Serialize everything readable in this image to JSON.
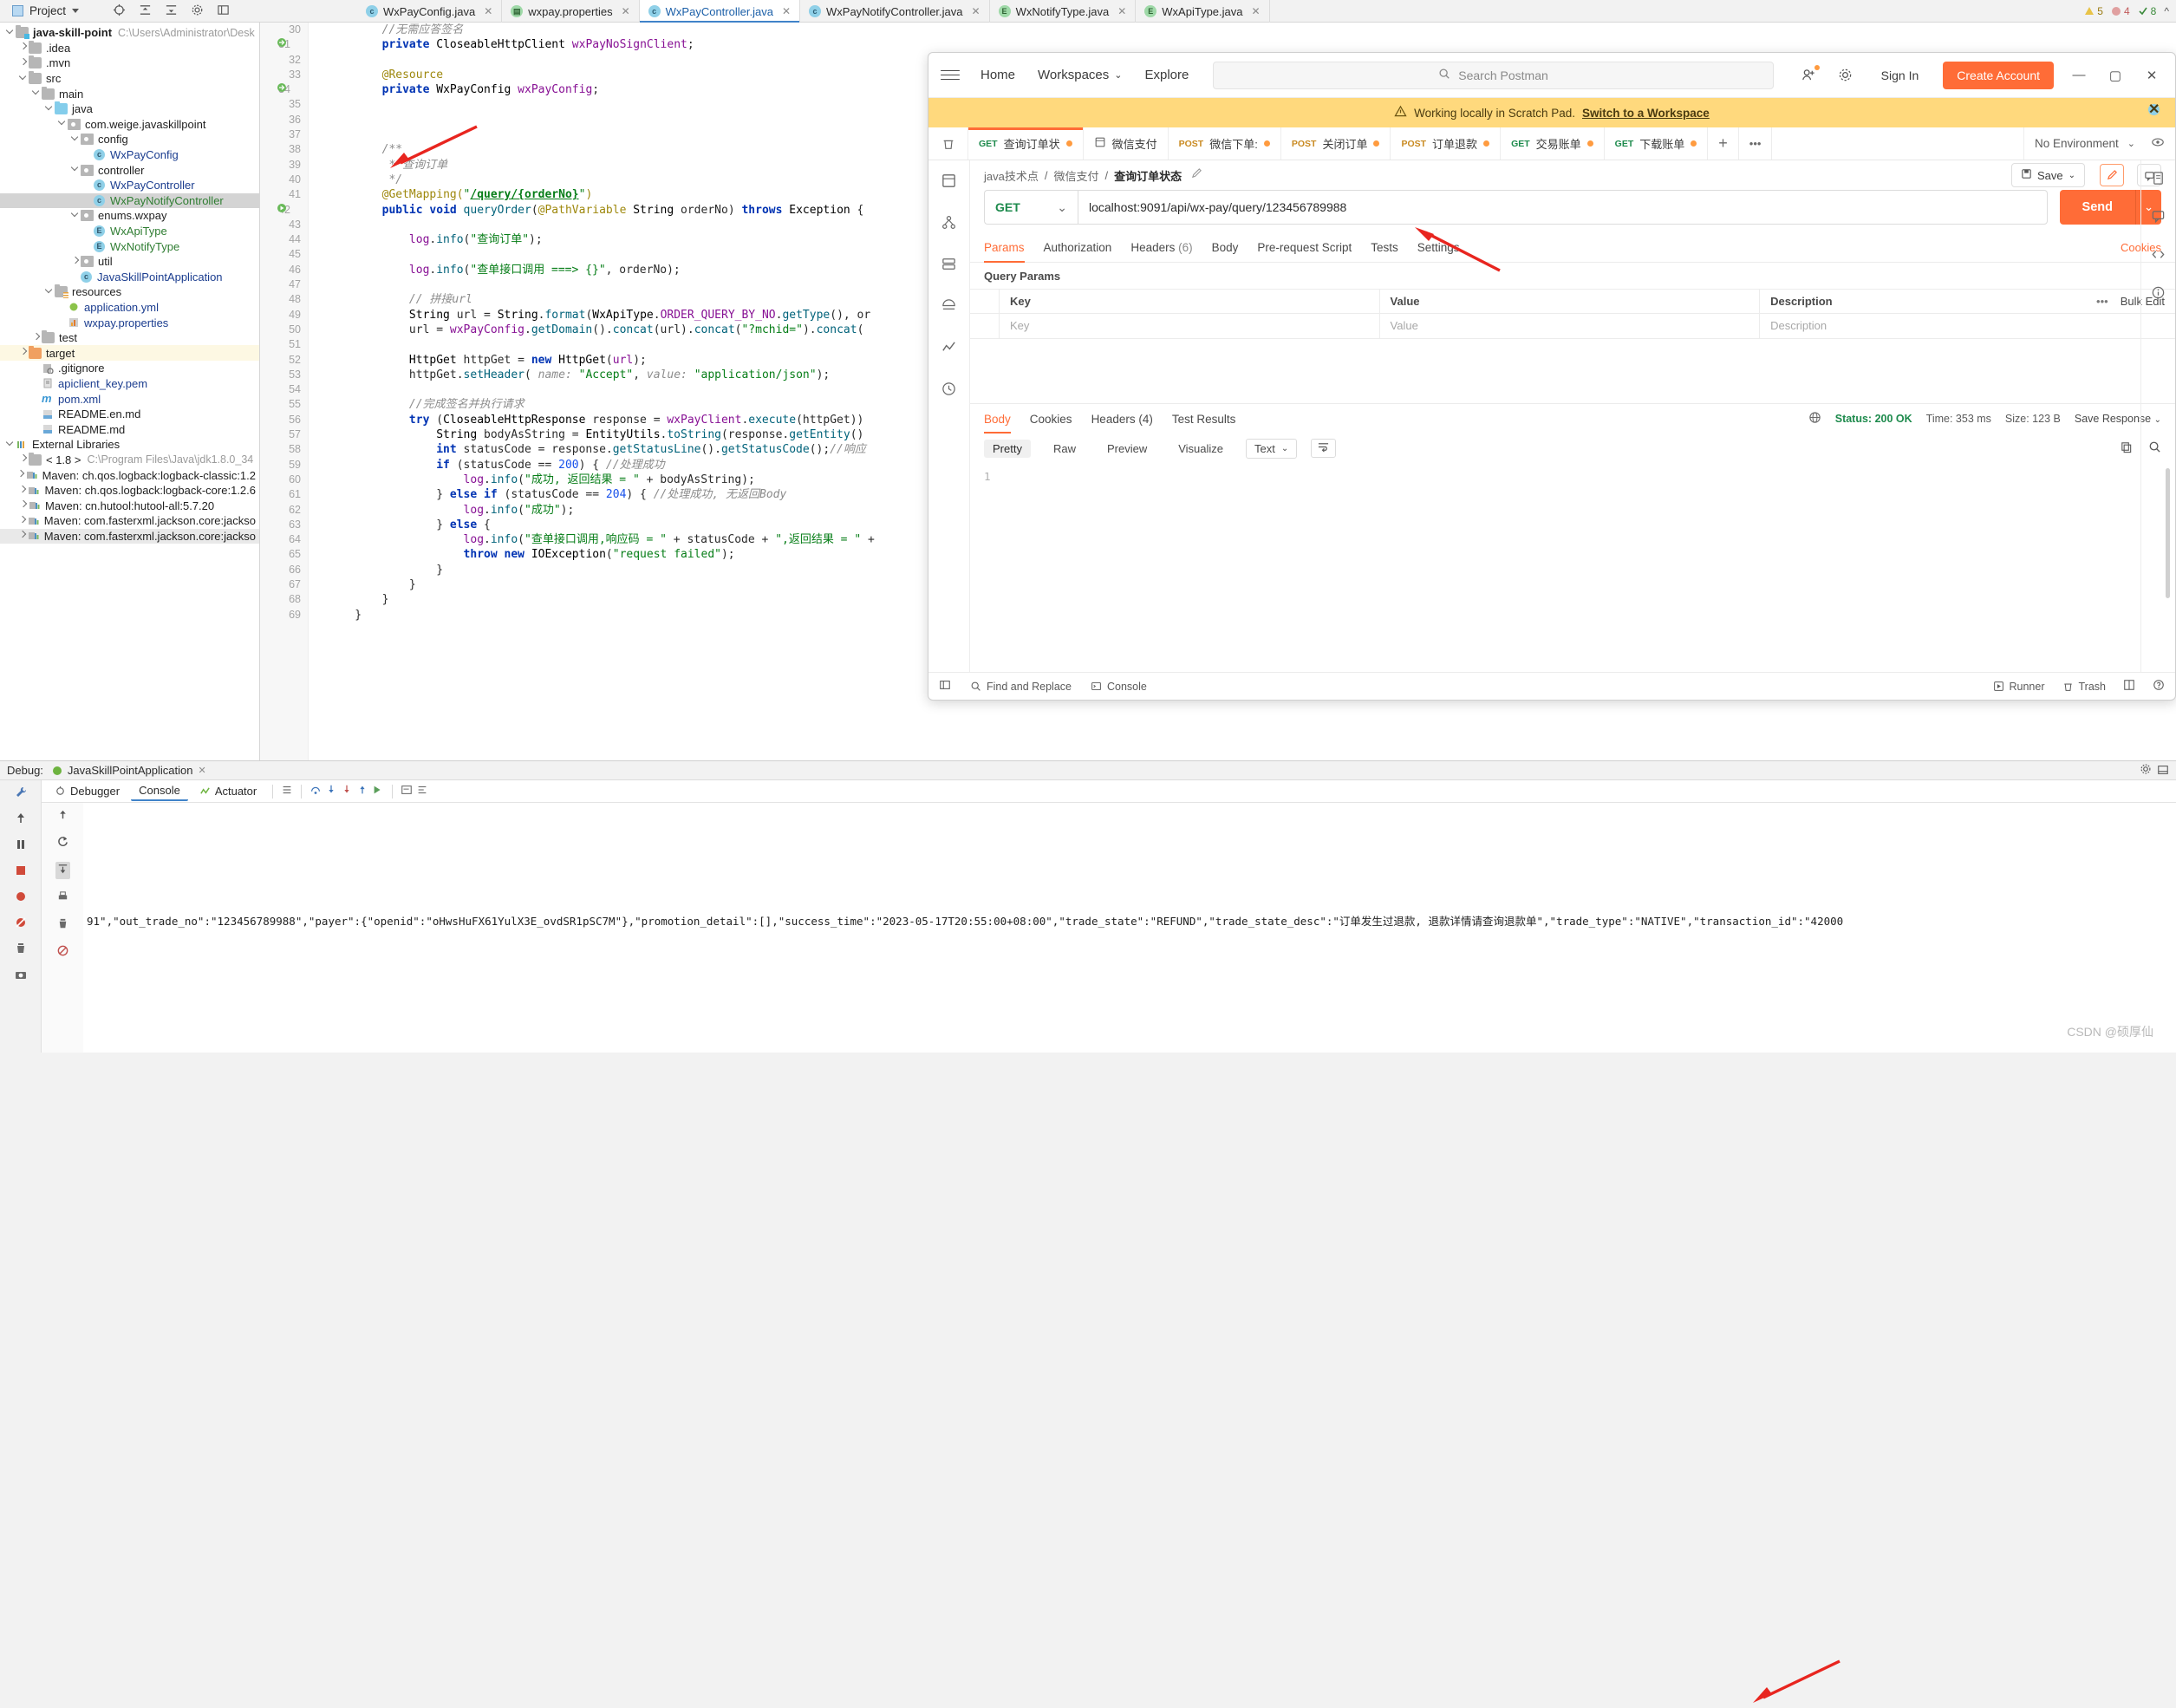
{
  "ide": {
    "toolbar": {
      "project_label": "Project",
      "status_warn": "5",
      "status_err": "4",
      "status_ok": "8"
    },
    "editor_tabs": [
      {
        "label": "WxPayConfig.java",
        "icon": "java-class-icon",
        "active": false
      },
      {
        "label": "wxpay.properties",
        "icon": "properties-file-icon",
        "active": false
      },
      {
        "label": "WxPayController.java",
        "icon": "java-class-icon",
        "active": true
      },
      {
        "label": "WxPayNotifyController.java",
        "icon": "java-class-icon",
        "active": false
      },
      {
        "label": "WxNotifyType.java",
        "icon": "java-enum-icon",
        "active": false
      },
      {
        "label": "WxApiType.java",
        "icon": "java-enum-icon",
        "active": false
      }
    ],
    "tree": [
      {
        "indent": 0,
        "chev": "down",
        "icon": "module-folder",
        "label": "java-skill-point",
        "bold": true,
        "path": "C:\\Users\\Administrator\\Desk",
        "color": "dark"
      },
      {
        "indent": 1,
        "chev": "right",
        "icon": "folder",
        "label": ".idea",
        "color": "dark"
      },
      {
        "indent": 1,
        "chev": "right",
        "icon": "folder",
        "label": ".mvn",
        "color": "dark"
      },
      {
        "indent": 1,
        "chev": "down",
        "icon": "folder",
        "label": "src",
        "color": "dark"
      },
      {
        "indent": 2,
        "chev": "down",
        "icon": "folder",
        "label": "main",
        "color": "dark"
      },
      {
        "indent": 3,
        "chev": "down",
        "icon": "source-folder",
        "label": "java",
        "color": "dark"
      },
      {
        "indent": 4,
        "chev": "down",
        "icon": "package",
        "label": "com.weige.javaskillpoint",
        "color": "dark"
      },
      {
        "indent": 5,
        "chev": "down",
        "icon": "package",
        "label": "config",
        "color": "dark"
      },
      {
        "indent": 6,
        "chev": "none",
        "icon": "class",
        "label": "WxPayConfig",
        "color": "blue"
      },
      {
        "indent": 5,
        "chev": "down",
        "icon": "package",
        "label": "controller",
        "color": "dark"
      },
      {
        "indent": 6,
        "chev": "none",
        "icon": "class",
        "label": "WxPayController",
        "color": "blue"
      },
      {
        "indent": 6,
        "chev": "none",
        "icon": "class",
        "label": "WxPayNotifyController",
        "color": "green",
        "selected": true
      },
      {
        "indent": 5,
        "chev": "down",
        "icon": "package",
        "label": "enums.wxpay",
        "color": "dark"
      },
      {
        "indent": 6,
        "chev": "none",
        "icon": "enum",
        "label": "WxApiType",
        "color": "green"
      },
      {
        "indent": 6,
        "chev": "none",
        "icon": "enum",
        "label": "WxNotifyType",
        "color": "green"
      },
      {
        "indent": 5,
        "chev": "right",
        "icon": "package",
        "label": "util",
        "color": "dark"
      },
      {
        "indent": 5,
        "chev": "none",
        "icon": "springboot",
        "label": "JavaSkillPointApplication",
        "color": "blue"
      },
      {
        "indent": 3,
        "chev": "down",
        "icon": "resource-folder",
        "label": "resources",
        "color": "dark"
      },
      {
        "indent": 4,
        "chev": "none",
        "icon": "yml",
        "label": "application.yml",
        "color": "blue"
      },
      {
        "indent": 4,
        "chev": "none",
        "icon": "properties",
        "label": "wxpay.properties",
        "color": "blue"
      },
      {
        "indent": 2,
        "chev": "right",
        "icon": "folder",
        "label": "test",
        "color": "dark"
      },
      {
        "indent": 1,
        "chev": "right",
        "icon": "target-folder",
        "label": "target",
        "color": "dark",
        "highlight": true
      },
      {
        "indent": 2,
        "chev": "none",
        "icon": "gitignore",
        "label": ".gitignore",
        "color": "dark"
      },
      {
        "indent": 2,
        "chev": "none",
        "icon": "pem",
        "label": "apiclient_key.pem",
        "color": "blue"
      },
      {
        "indent": 2,
        "chev": "none",
        "icon": "maven",
        "label": "pom.xml",
        "color": "blue"
      },
      {
        "indent": 2,
        "chev": "none",
        "icon": "markdown",
        "label": "README.en.md",
        "color": "dark"
      },
      {
        "indent": 2,
        "chev": "none",
        "icon": "markdown",
        "label": "README.md",
        "color": "dark"
      },
      {
        "indent": 0,
        "chev": "down",
        "icon": "libraries",
        "label": "External Libraries",
        "color": "dark"
      },
      {
        "indent": 1,
        "chev": "right",
        "icon": "jdk",
        "label": "< 1.8 >",
        "path": "C:\\Program Files\\Java\\jdk1.8.0_34",
        "color": "dark"
      },
      {
        "indent": 1,
        "chev": "right",
        "icon": "lib",
        "label": "Maven: ch.qos.logback:logback-classic:1.2",
        "color": "dark"
      },
      {
        "indent": 1,
        "chev": "right",
        "icon": "lib",
        "label": "Maven: ch.qos.logback:logback-core:1.2.6",
        "color": "dark"
      },
      {
        "indent": 1,
        "chev": "right",
        "icon": "lib",
        "label": "Maven: cn.hutool:hutool-all:5.7.20",
        "color": "dark"
      },
      {
        "indent": 1,
        "chev": "right",
        "icon": "lib",
        "label": "Maven: com.fasterxml.jackson.core:jackso",
        "color": "dark"
      },
      {
        "indent": 1,
        "chev": "right",
        "icon": "lib",
        "label": "Maven: com.fasterxml.jackson.core:jackso",
        "color": "dark",
        "selected2": true
      }
    ],
    "code": {
      "first_line": 30,
      "lines": [
        {
          "n": 30,
          "html": "        <span class='cm'>//无需应答签名</span>"
        },
        {
          "n": 31,
          "html": "        <span class='k'>private</span> <span class='ty'>CloseableHttpClient</span> <span class='fld'>wxPayNoSignClient</span>;",
          "mark": "override"
        },
        {
          "n": 32,
          "html": ""
        },
        {
          "n": 33,
          "html": "        <span class='an'>@Resource</span>"
        },
        {
          "n": 34,
          "html": "        <span class='k'>private</span> <span class='ty'>WxPayConfig</span> <span class='fld'>wxPayConfig</span>;",
          "mark": "override"
        },
        {
          "n": 35,
          "html": "",
          "fold": "run"
        },
        {
          "n": 36,
          "html": "",
          "fold": "run"
        },
        {
          "n": 37,
          "html": ""
        },
        {
          "n": 38,
          "html": "        <span class='cm'>/**</span>",
          "fold": "open"
        },
        {
          "n": 39,
          "html": "         <span class='cm'>* 查询订单</span>"
        },
        {
          "n": 40,
          "html": "         <span class='cm'>*/</span>",
          "fold": "close"
        },
        {
          "n": 41,
          "html": "        <span class='an'>@GetMapping(</span><span class='st'>\"</span><span class='ul'>/query/{orderNo}</span><span class='st'>\"</span><span class='an'>)</span>"
        },
        {
          "n": 42,
          "html": "        <span class='k'>public void</span> <span class='mth'>queryOrder</span>(<span class='an'>@PathVariable</span> <span class='ty'>String</span> orderNo) <span class='k'>throws</span> <span class='ty'>Exception</span> {",
          "mark": "run",
          "fold": "open"
        },
        {
          "n": 43,
          "html": ""
        },
        {
          "n": 44,
          "html": "            <span class='fld'>log</span>.<span class='mth'>info</span>(<span class='st'>\"查询订单\"</span>);"
        },
        {
          "n": 45,
          "html": ""
        },
        {
          "n": 46,
          "html": "            <span class='fld'>log</span>.<span class='mth'>info</span>(<span class='st'>\"查单接口调用 ===&gt; {}\"</span>, orderNo);"
        },
        {
          "n": 47,
          "html": ""
        },
        {
          "n": 48,
          "html": "            <span class='cm'>// 拼接url</span>"
        },
        {
          "n": 49,
          "html": "            <span class='ty'>String</span> url = <span class='ty'>String</span>.<span class='mth'>format</span>(<span class='ty'>WxApiType</span>.<span class='fld'>ORDER_QUERY_BY_NO</span>.<span class='mth'>getType</span>(), or"
        },
        {
          "n": 50,
          "html": "            url = <span class='fld'>wxPayConfig</span>.<span class='mth'>getDomain</span>().<span class='mth'>concat</span>(url).<span class='mth'>concat</span>(<span class='st'>\"?mchid=\"</span>).<span class='mth'>concat</span>("
        },
        {
          "n": 51,
          "html": ""
        },
        {
          "n": 52,
          "html": "            <span class='ty'>HttpGet</span> httpGet = <span class='k'>new</span> <span class='ty'>HttpGet</span>(<span class='fld'>url</span>);"
        },
        {
          "n": 53,
          "html": "            httpGet.<span class='mth'>setHeader</span>( <span class='cm'>name:</span> <span class='st'>\"Accept\"</span>, <span class='cm'>value:</span> <span class='st'>\"application/json\"</span>);"
        },
        {
          "n": 54,
          "html": ""
        },
        {
          "n": 55,
          "html": "            <span class='cm'>//完成签名并执行请求</span>"
        },
        {
          "n": 56,
          "html": "            <span class='k'>try</span> (<span class='ty'>CloseableHttpResponse</span> response = <span class='fld'>wxPayClient</span>.<span class='mth'>execute</span>(httpGet))",
          "fold": "open"
        },
        {
          "n": 57,
          "html": "                <span class='ty'>String</span> bodyAsString = <span class='ty'>EntityUtils</span>.<span class='mth'>toString</span>(response.<span class='mth'>getEntity</span>()"
        },
        {
          "n": 58,
          "html": "                <span class='k'>int</span> statusCode = response.<span class='mth'>getStatusLine</span>().<span class='mth'>getStatusCode</span>();<span class='cm'>//响应</span>"
        },
        {
          "n": 59,
          "html": "                <span class='k'>if</span> (statusCode == <span class='nu'>200</span>) { <span class='cm'>//处理成功</span>"
        },
        {
          "n": 60,
          "html": "                    <span class='fld'>log</span>.<span class='mth'>info</span>(<span class='st'>\"成功, 返回结果 = \"</span> + bodyAsString);"
        },
        {
          "n": 61,
          "html": "                } <span class='k'>else if</span> (statusCode == <span class='nu'>204</span>) { <span class='cm'>//处理成功, 无返回Body</span>"
        },
        {
          "n": 62,
          "html": "                    <span class='fld'>log</span>.<span class='mth'>info</span>(<span class='st'>\"成功\"</span>);"
        },
        {
          "n": 63,
          "html": "                } <span class='k'>else</span> {"
        },
        {
          "n": 64,
          "html": "                    <span class='fld'>log</span>.<span class='mth'>info</span>(<span class='st'>\"查单接口调用,响应码 = \"</span> + statusCode + <span class='st'>\",返回结果 = \"</span> +"
        },
        {
          "n": 65,
          "html": "                    <span class='k'>throw new</span> <span class='ty'>IOException</span>(<span class='st'>\"request failed\"</span>);"
        },
        {
          "n": 66,
          "html": "                }"
        },
        {
          "n": 67,
          "html": "            }"
        },
        {
          "n": 68,
          "html": "        }"
        },
        {
          "n": 69,
          "html": "    }"
        }
      ]
    },
    "debug": {
      "label": "Debug:",
      "config_name": "JavaSkillPointApplication",
      "tabs": [
        {
          "label": "Debugger",
          "icon": "debugger-icon",
          "active": false
        },
        {
          "label": "Console",
          "icon": "console-icon",
          "active": true
        },
        {
          "label": "Actuator",
          "icon": "actuator-icon",
          "active": false
        }
      ],
      "console_text": "91\",\"out_trade_no\":\"123456789988\",\"payer\":{\"openid\":\"oHwsHuFX61YulX3E_ovdSR1pSC7M\"},\"promotion_detail\":[],\"success_time\":\"2023-05-17T20:55:00+08:00\",\"trade_state\":\"REFUND\",\"trade_state_desc\":\"订单发生过退款, 退款详情请查询退款单\",\"trade_type\":\"NATIVE\",\"transaction_id\":\"42000"
    },
    "watermark": "CSDN @硕厚仙"
  },
  "postman": {
    "titlebar": {
      "menu_icon": "hamburger-icon",
      "nav": [
        {
          "label": "Home",
          "caret": false
        },
        {
          "label": "Workspaces",
          "caret": true
        },
        {
          "label": "Explore",
          "caret": false
        }
      ],
      "search_placeholder": "Search Postman",
      "search_icon": "search-icon",
      "invite_icon": "invite-icon",
      "settings_icon": "gear-icon",
      "signin_label": "Sign In",
      "create_account_label": "Create Account",
      "minimize_icon": "minimize-icon",
      "maximize_icon": "maximize-icon",
      "close_icon": "close-icon"
    },
    "banner": {
      "icon": "warning-icon",
      "text": "Working locally in Scratch Pad.",
      "link": "Switch to a Workspace",
      "close_icon": "close-icon"
    },
    "tabs": [
      {
        "verb": "GET",
        "label": "查询订单状",
        "dirty": true,
        "active": true,
        "icon": ""
      },
      {
        "verb": "",
        "label": "微信支付",
        "dirty": false,
        "active": false,
        "icon": "collection-icon"
      },
      {
        "verb": "POST",
        "label": "微信下单:",
        "dirty": true,
        "active": false
      },
      {
        "verb": "POST",
        "label": "关闭订单",
        "dirty": true,
        "active": false
      },
      {
        "verb": "POST",
        "label": "订单退款",
        "dirty": true,
        "active": false
      },
      {
        "verb": "GET",
        "label": "交易账单",
        "dirty": true,
        "active": false
      },
      {
        "verb": "GET",
        "label": "下载账单",
        "dirty": true,
        "active": false
      }
    ],
    "tab_add_label": "+",
    "tab_more_label": "•••",
    "environment": {
      "value": "No Environment",
      "eye_icon": "eye-icon",
      "caret_icon": "chevron-down-icon"
    },
    "breadcrumb": {
      "parts": [
        "java技术点",
        "微信支付"
      ],
      "current": "查询订单状态",
      "edit_icon": "pencil-icon"
    },
    "save_label": "Save",
    "save_icon": "save-icon",
    "request": {
      "method": "GET",
      "method_caret": "chevron-down-icon",
      "url": "localhost:9091/api/wx-pay/query/123456789988",
      "send_label": "Send",
      "send_caret": "chevron-down-icon"
    },
    "request_tabs": [
      {
        "label": "Params",
        "count": "",
        "active": true
      },
      {
        "label": "Authorization",
        "count": "",
        "active": false
      },
      {
        "label": "Headers",
        "count": "(6)",
        "active": false
      },
      {
        "label": "Body",
        "count": "",
        "active": false
      },
      {
        "label": "Pre-request Script",
        "count": "",
        "active": false
      },
      {
        "label": "Tests",
        "count": "",
        "active": false
      },
      {
        "label": "Settings",
        "count": "",
        "active": false
      }
    ],
    "cookies_label": "Cookies",
    "params": {
      "title": "Query Params",
      "columns": [
        "Key",
        "Value",
        "Description"
      ],
      "bulk_edit_label": "Bulk Edit",
      "more_icon": "ellipsis-icon",
      "row_placeholders": [
        "Key",
        "Value",
        "Description"
      ]
    },
    "response_tabs": [
      {
        "label": "Body",
        "active": true
      },
      {
        "label": "Cookies",
        "active": false
      },
      {
        "label": "Headers (4)",
        "active": false
      },
      {
        "label": "Test Results",
        "active": false
      }
    ],
    "response_status": {
      "globe_icon": "globe-icon",
      "status": "Status: 200 OK",
      "time": "Time: 353 ms",
      "size": "Size: 123 B",
      "save_response_label": "Save Response",
      "save_caret": "chevron-down-icon"
    },
    "format_bar": {
      "modes": [
        "Pretty",
        "Raw",
        "Preview",
        "Visualize"
      ],
      "active_mode": "Pretty",
      "type": "Text",
      "type_caret": "chevron-down-icon",
      "wrap_icon": "wrap-lines-icon",
      "copy_icon": "copy-icon",
      "search_icon": "search-icon"
    },
    "response_body_line_number": "1",
    "footer": {
      "sidebar_icon": "toggle-sidebar-icon",
      "find_replace": "Find and Replace",
      "console": "Console",
      "runner": "Runner",
      "trash": "Trash",
      "layout_icon": "layout-icon",
      "help_icon": "help-icon"
    },
    "rail_icons": [
      "collections-icon",
      "apis-icon",
      "environments-icon",
      "mock-icon",
      "monitors-icon",
      "history-icon"
    ],
    "rail_right_icons": [
      "documentation-icon",
      "comments-icon",
      "code-icon",
      "info-icon"
    ]
  }
}
